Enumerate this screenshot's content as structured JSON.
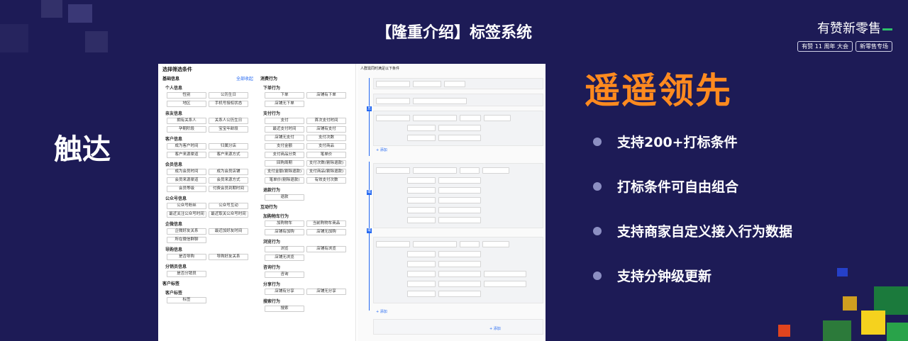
{
  "slide": {
    "title": "【隆重介绍】标签系统",
    "left_heading": "触达",
    "right_heading": "遥遥领先",
    "features": [
      "支持200+打标条件",
      "打标条件可自由组合",
      "支持商家自定义接入行为数据",
      "支持分钟级更新"
    ]
  },
  "brand": {
    "name": "有赞新零售",
    "tags": [
      "有赞 11 周年 大会",
      "新零售专场"
    ]
  },
  "colors": {
    "background": "#1d1b56",
    "accent_orange": "#ff8a1f",
    "link_blue": "#2468f2"
  },
  "panel": {
    "condition_title": "选择筛选条件",
    "basic_title": "基础信息",
    "collapse_all": "全部收起",
    "basic_groups": [
      {
        "name": "个人信息",
        "items": [
          "性别",
          "公历生日",
          "地区",
          "手机号授权状态"
        ]
      },
      {
        "name": "亲友信息",
        "items": [
          "拥有关系人",
          "关系人公历生日",
          "孕期阶段",
          "宝宝年龄段"
        ]
      },
      {
        "name": "客户信息",
        "items": [
          "成为客户时间",
          "归属分店",
          "客户来源渠道",
          "客户来源方式"
        ]
      },
      {
        "name": "会员信息",
        "items": [
          "成为会员时间",
          "成为会员店铺",
          "会员来源渠道",
          "会员来源方式",
          "会员等级",
          "付费会员到期时间"
        ]
      },
      {
        "name": "公众号信息",
        "items": [
          "公众号粉丝",
          "公众号互动",
          "最近关注公众号时间",
          "最近取关公众号时间"
        ]
      },
      {
        "name": "企微信息",
        "items": [
          "企微好友关系",
          "最近加好友时间",
          "所在微信群聊"
        ]
      },
      {
        "name": "导购信息",
        "items": [
          "是否导购",
          "导购好友关系"
        ]
      },
      {
        "name": "分销员信息",
        "items": [
          "是否分销员"
        ]
      }
    ],
    "customer_tag_title": "客户标签",
    "customer_tag_group": {
      "name": "客户标签",
      "items": [
        "标签"
      ]
    },
    "behavior_title": "消费行为",
    "behavior_groups": [
      {
        "name": "下单行为",
        "items": [
          "下单",
          "店铺有下单",
          "店铺无下单"
        ]
      },
      {
        "name": "支付行为",
        "items": [
          "支付",
          "首次支付时间",
          "最近支付时间",
          "店铺有支付",
          "店铺无支付",
          "支付次数",
          "支付金额",
          "支付商品",
          "支付商品分类",
          "笔单价",
          "回购周期",
          "支付次数(剔除退款)",
          "支付金额(剔除退款)",
          "支付商品(剔除退款)",
          "笔单价(剔除退款)",
          "有效支付次数"
        ]
      },
      {
        "name": "退款行为",
        "items": [
          "退款"
        ]
      }
    ],
    "interaction_title": "互动行为",
    "interaction_groups": [
      {
        "name": "加购物车行为",
        "items": [
          "加购物车",
          "当前购物车商品",
          "店铺有加购",
          "店铺无加购"
        ]
      },
      {
        "name": "浏览行为",
        "items": [
          "浏览",
          "店铺有浏览",
          "店铺无浏览"
        ]
      },
      {
        "name": "咨询行为",
        "items": [
          "咨询"
        ]
      },
      {
        "name": "分享行为",
        "items": [
          "店铺有分享",
          "店铺无分享"
        ]
      },
      {
        "name": "搜索行为",
        "items": [
          "搜索"
        ]
      }
    ],
    "flow_title": "人群需同时满足以下条件",
    "flow_badges": [
      "且",
      "或",
      "或"
    ],
    "add_label": "+ 添加"
  }
}
